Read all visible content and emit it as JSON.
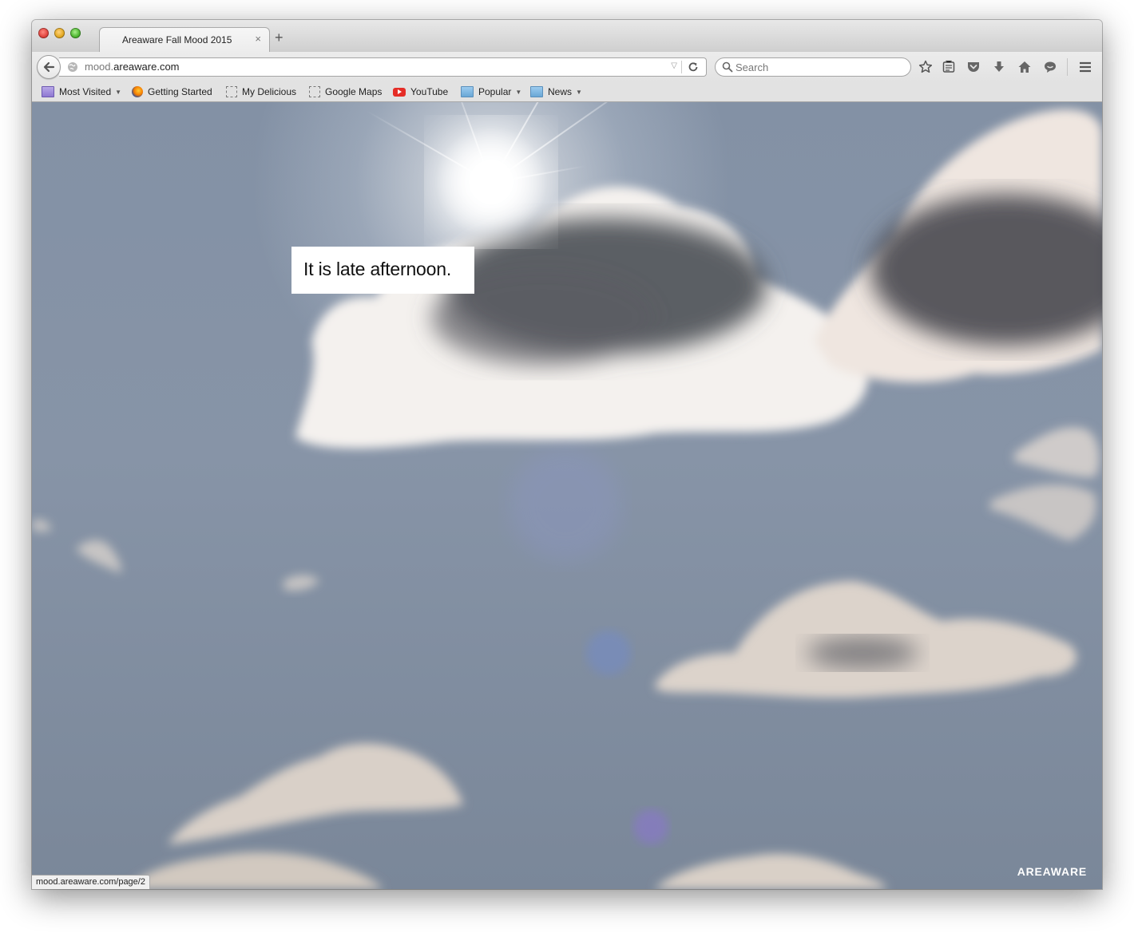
{
  "browser": {
    "tab_title": "Areaware Fall Mood 2015",
    "tab_close": "×",
    "new_tab": "+",
    "url_prefix": "mood.",
    "url_domain": "areaware.com",
    "search_placeholder": "Search",
    "status_url": "mood.areaware.com/page/2"
  },
  "bookmarks": [
    {
      "label": "Most Visited",
      "icon": "folder-icon",
      "dropdown": true
    },
    {
      "label": "Getting Started",
      "icon": "firefox-icon"
    },
    {
      "label": "My Delicious",
      "icon": "bookmark-placeholder-icon"
    },
    {
      "label": "Google Maps",
      "icon": "bookmark-placeholder-icon"
    },
    {
      "label": "YouTube",
      "icon": "youtube-icon"
    },
    {
      "label": "Popular",
      "icon": "folder-icon",
      "dropdown": true
    },
    {
      "label": "News",
      "icon": "folder-icon",
      "dropdown": true
    }
  ],
  "toolbar_icons": [
    "star-icon",
    "reading-list-icon",
    "pocket-icon",
    "download-icon",
    "home-icon",
    "chat-icon",
    "menu-icon"
  ],
  "page": {
    "mood_text": "It is late afternoon.",
    "brand": "AREAWARE"
  },
  "colors": {
    "sky": "#8391a5",
    "caption_bg": "#ffffff"
  }
}
